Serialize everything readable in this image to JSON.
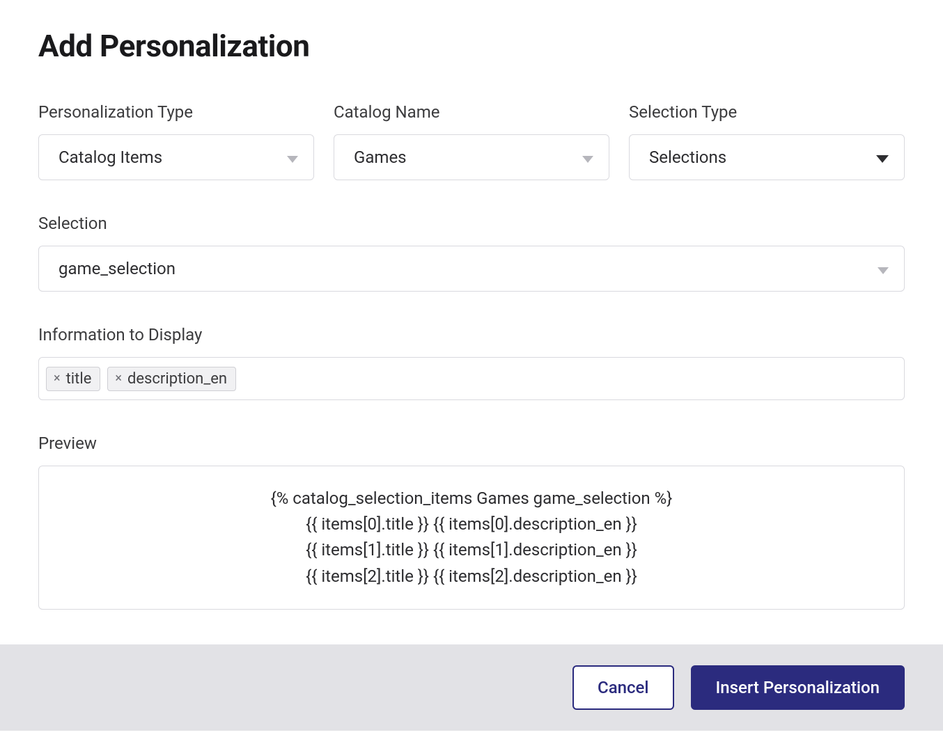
{
  "title": "Add Personalization",
  "fields": {
    "personalization_type": {
      "label": "Personalization Type",
      "value": "Catalog Items"
    },
    "catalog_name": {
      "label": "Catalog Name",
      "value": "Games"
    },
    "selection_type": {
      "label": "Selection Type",
      "value": "Selections"
    },
    "selection": {
      "label": "Selection",
      "value": "game_selection"
    },
    "info_to_display": {
      "label": "Information to Display"
    },
    "preview": {
      "label": "Preview"
    }
  },
  "tags": [
    {
      "label": "title"
    },
    {
      "label": "description_en"
    }
  ],
  "preview_lines": [
    "{% catalog_selection_items Games game_selection %}",
    "{{ items[0].title }} {{ items[0].description_en }}",
    "{{ items[1].title }} {{ items[1].description_en }}",
    "{{ items[2].title }} {{ items[2].description_en }}"
  ],
  "buttons": {
    "cancel": "Cancel",
    "insert": "Insert Personalization"
  }
}
